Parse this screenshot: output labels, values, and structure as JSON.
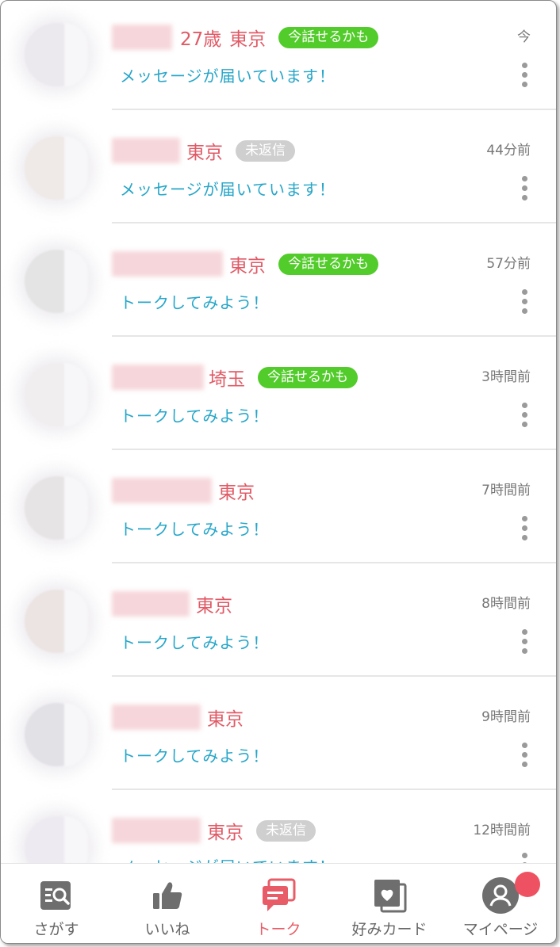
{
  "rows": [
    {
      "age": "27歳",
      "location": "東京",
      "badge": "今話せるかも",
      "badge_type": "green",
      "time": "今",
      "message": "メッセージが届いています！"
    },
    {
      "age": "",
      "location": "東京",
      "badge": "未返信",
      "badge_type": "gray",
      "time": "44分前",
      "message": "メッセージが届いています！"
    },
    {
      "age": "",
      "location": "東京",
      "badge": "今話せるかも",
      "badge_type": "green",
      "time": "57分前",
      "message": "トークしてみよう！"
    },
    {
      "age": "",
      "location": "埼玉",
      "badge": "今話せるかも",
      "badge_type": "green",
      "time": "3時間前",
      "message": "トークしてみよう！"
    },
    {
      "age": "",
      "location": "東京",
      "badge": "",
      "badge_type": "",
      "time": "7時間前",
      "message": "トークしてみよう！"
    },
    {
      "age": "",
      "location": "東京",
      "badge": "",
      "badge_type": "",
      "time": "8時間前",
      "message": "トークしてみよう！"
    },
    {
      "age": "",
      "location": "東京",
      "badge": "",
      "badge_type": "",
      "time": "9時間前",
      "message": "トークしてみよう！"
    },
    {
      "age": "",
      "location": "東京",
      "badge": "未返信",
      "badge_type": "gray",
      "time": "12時間前",
      "message": "メッセージが届いています！"
    }
  ],
  "tabs": {
    "search": "さがす",
    "likes": "いいね",
    "talk": "トーク",
    "cards": "好みカード",
    "mypage": "マイページ"
  },
  "colors": {
    "accent": "#e85c67",
    "message": "#27a6c9",
    "badge_green": "#52cc2a",
    "badge_gray": "#cfcfcf"
  },
  "icons": [
    "search-icon",
    "thumbs-up-icon",
    "chat-icon",
    "heart-card-icon",
    "profile-icon",
    "more-vertical-icon"
  ]
}
